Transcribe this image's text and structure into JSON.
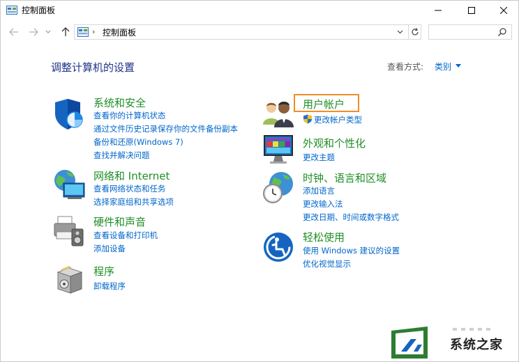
{
  "window": {
    "title": "控制面板"
  },
  "address": {
    "path": "控制面板",
    "separator": "›"
  },
  "search": {
    "placeholder": ""
  },
  "content": {
    "heading": "调整计算机的设置",
    "view_by_label": "查看方式:",
    "view_by_value": "类别"
  },
  "categories": {
    "system": {
      "title": "系统和安全",
      "links": [
        "查看你的计算机状态",
        "通过文件历史记录保存你的文件备份副本",
        "备份和还原(Windows 7)",
        "查找并解决问题"
      ]
    },
    "network": {
      "title": "网络和 Internet",
      "links": [
        "查看网络状态和任务",
        "选择家庭组和共享选项"
      ]
    },
    "hardware": {
      "title": "硬件和声音",
      "links": [
        "查看设备和打印机",
        "添加设备"
      ]
    },
    "programs": {
      "title": "程序",
      "links": [
        "卸载程序"
      ]
    },
    "user_accounts": {
      "title": "用户帐户",
      "links": [
        "更改帐户类型"
      ]
    },
    "appearance": {
      "title": "外观和个性化",
      "links": [
        "更改主题"
      ]
    },
    "clock": {
      "title": "时钟、语言和区域",
      "links": [
        "添加语言",
        "更改输入法",
        "更改日期、时间或数字格式"
      ]
    },
    "ease": {
      "title": "轻松使用",
      "links": [
        "使用 Windows 建议的设置",
        "优化视觉显示"
      ]
    }
  },
  "watermark": {
    "text": "系统之家"
  },
  "colors": {
    "category_title": "#1f8e26",
    "link": "#0066cc",
    "heading": "#1e3287",
    "highlight": "#f28c28"
  }
}
